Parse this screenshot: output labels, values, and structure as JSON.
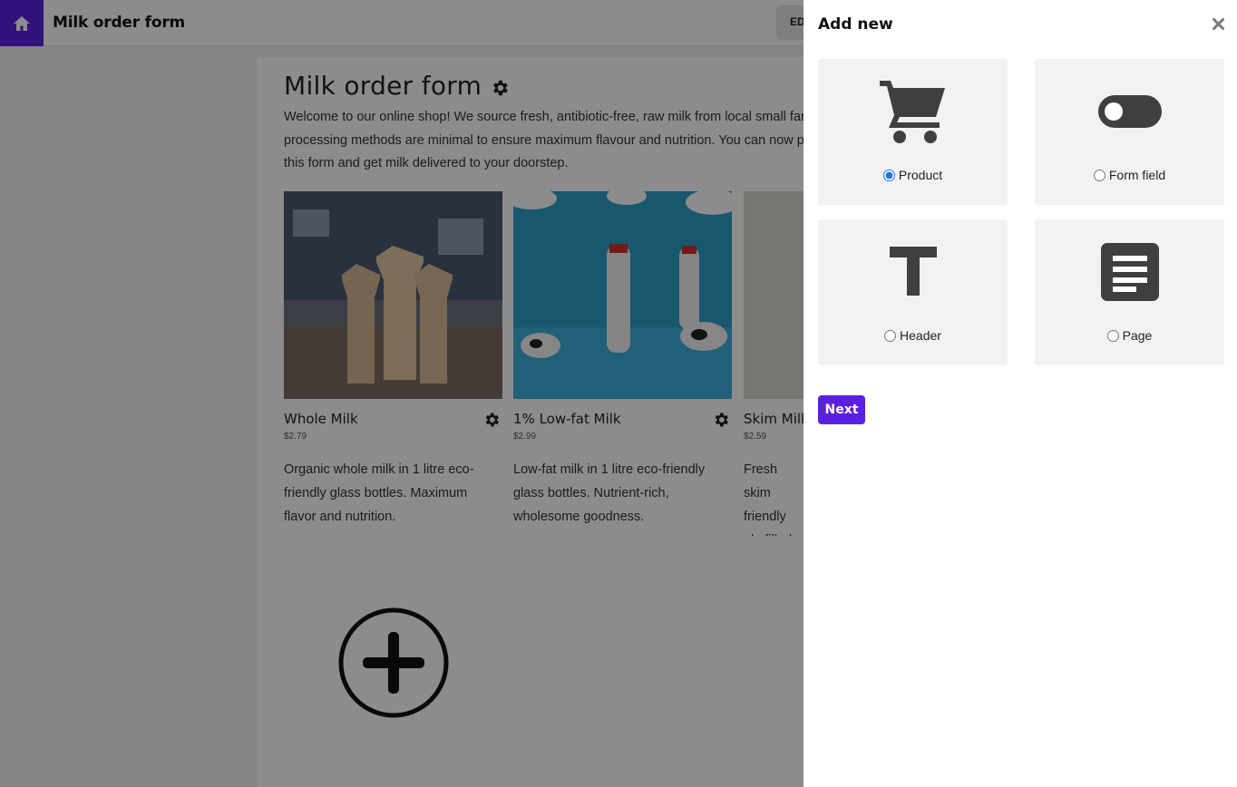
{
  "topbar": {
    "home_icon": "home-icon",
    "title": "Milk order form",
    "edit_label": "ED"
  },
  "form": {
    "heading": "Milk order form",
    "intro": "Welcome to our online shop! We source fresh, antibiotic-free, raw milk from local small far\nprocessing methods are minimal to ensure maximum flavour and nutrition. You can now p\nthis form and get milk delivered to your doorstep.",
    "products": [
      {
        "name": "Whole Milk",
        "price": "$2.79",
        "description": "Organic whole milk in 1 litre eco-friendly glass bottles. Maximum flavor and nutrition."
      },
      {
        "name": "1% Low-fat Milk",
        "price": "$2.99",
        "description": "Low-fat milk in 1 litre eco-friendly glass bottles. Nutrient-rich, wholesome goodness."
      },
      {
        "name": "Skim Milk",
        "price": "$2.59",
        "description": "Fresh skim friendly gla filled with"
      }
    ]
  },
  "panel": {
    "title": "Add new",
    "close_icon": "close-icon",
    "options": [
      {
        "label": "Product",
        "icon": "cart-icon",
        "selected": true
      },
      {
        "label": "Form field",
        "icon": "toggle-icon",
        "selected": false
      },
      {
        "label": "Header",
        "icon": "text-icon",
        "selected": false
      },
      {
        "label": "Page",
        "icon": "page-icon",
        "selected": false
      }
    ],
    "next_label": "Next"
  },
  "colors": {
    "accent": "#5b1fe0",
    "overlay": "rgba(0,0,0,0.45)",
    "option_bg": "#f2f2f4",
    "icon": "#3f3f3f"
  }
}
